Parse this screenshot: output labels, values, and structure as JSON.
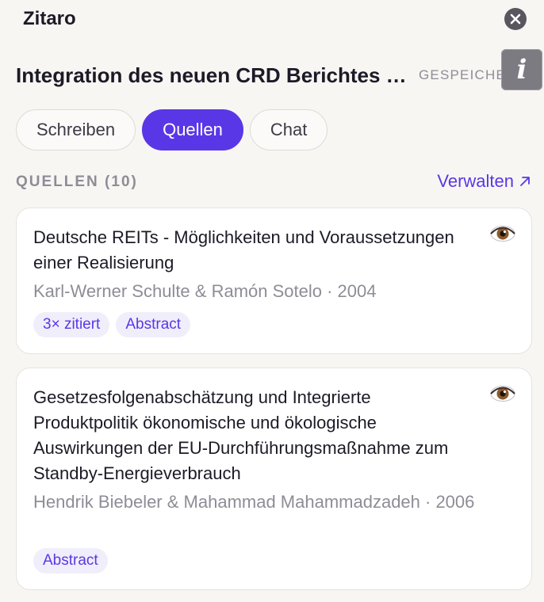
{
  "app": {
    "title": "Zitaro"
  },
  "document": {
    "title": "Integration des neuen CRD Berichtes über die Kapitalanlagen",
    "save_status": "GESPEICHERT"
  },
  "tabs": [
    {
      "label": "Schreiben"
    },
    {
      "label": "Quellen"
    },
    {
      "label": "Chat"
    }
  ],
  "sources": {
    "heading": "QUELLEN (10)",
    "manage_label": "Verwalten",
    "items": [
      {
        "title": "Deutsche REITs - Möglichkeiten und Voraussetzungen einer Realisierung",
        "meta": "Karl-Werner Schulte & Ramón Sotelo · 2004",
        "tags": [
          "3× zitiert",
          "Abstract"
        ]
      },
      {
        "title": "Gesetzesfolgenabschätzung und Integrierte Produktpolitik ökonomische und ökologische Auswirkungen der EU-Durchführungsmaßnahme zum Standby-Energieverbrauch",
        "meta": "Hendrik Biebeler & Mahammad Mahammadzadeh · 2006",
        "tags": [
          "Abstract"
        ]
      }
    ]
  },
  "icons": {
    "close": "close-icon",
    "info": "info-icon",
    "eye": "eye-icon",
    "arrow": "arrow-up-right-icon"
  },
  "colors": {
    "accent": "#5a37e6",
    "background": "#f8f6f3",
    "tag_bg": "#f0eefb"
  }
}
